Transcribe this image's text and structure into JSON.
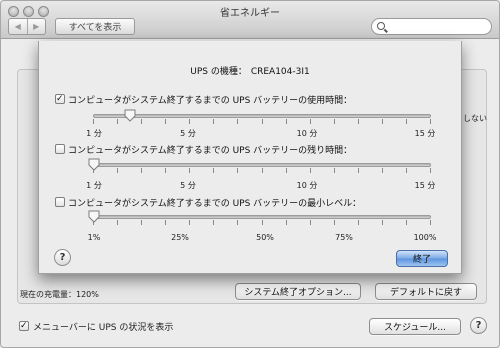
{
  "window": {
    "title": "省エネルギー",
    "show_all_label": "すべてを表示",
    "nav_back": "◀",
    "nav_forward": "▶"
  },
  "background": {
    "right_fragment": "しない",
    "charge_label": "現在の充電量：120%",
    "shutdown_options_button": "システム終了オプション...",
    "defaults_button": "デフォルトに戻す",
    "menubar_checkbox_label": "メニューバーに UPS の状況を表示",
    "menubar_checked": true,
    "schedule_button": "スケジュール...",
    "help_label": "?"
  },
  "sheet": {
    "ups_model_label": "UPS の機種：",
    "ups_model_value": "CREA104-3I1",
    "options": [
      {
        "label": "コンピュータがシステム終了するまでの UPS バッテリーの使用時間：",
        "checked": true,
        "slider_fraction": 0.107,
        "tick_labels": [
          "1 分",
          "5 分",
          "10 分",
          "15 分"
        ]
      },
      {
        "label": "コンピュータがシステム終了するまでの UPS バッテリーの残り時間：",
        "checked": false,
        "slider_fraction": 0.0,
        "tick_labels": [
          "1 分",
          "5 分",
          "10 分",
          "15 分"
        ]
      },
      {
        "label": "コンピュータがシステム終了するまでの UPS バッテリーの最小レベル：",
        "checked": false,
        "slider_fraction": 0.0,
        "tick_labels": [
          "1%",
          "25%",
          "50%",
          "75%",
          "100%"
        ]
      }
    ],
    "help_label": "?",
    "done_button": "終了"
  }
}
